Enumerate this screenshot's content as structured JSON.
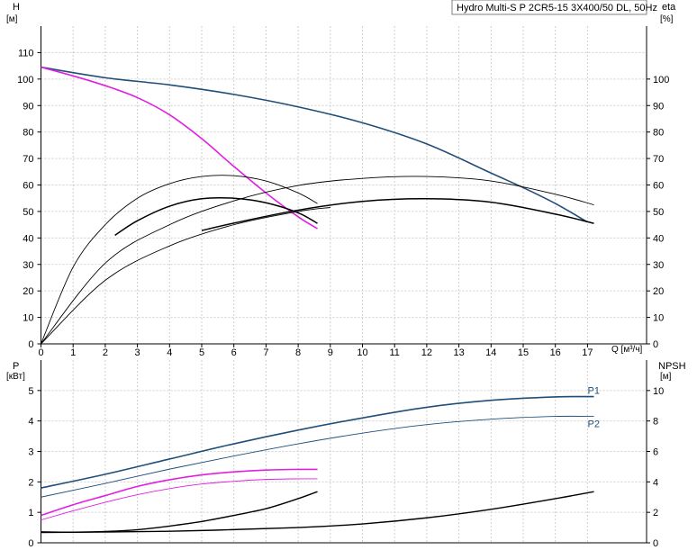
{
  "chart_data": [
    {
      "type": "line",
      "title": "Hydro Multi-S P 2CR5-15 3X400/50 DL, 50Hz",
      "xlabel": "Q [м³/ч]",
      "ylabel_left": "H",
      "ylabel_left_unit": "[м]",
      "ylabel_right": "eta",
      "ylabel_right_unit": "[%]",
      "xlim": [
        0,
        18
      ],
      "ylim": [
        0,
        120
      ],
      "x_ticks": [
        0,
        1,
        2,
        3,
        4,
        5,
        6,
        7,
        8,
        9,
        10,
        11,
        12,
        13,
        14,
        15,
        16,
        17
      ],
      "y_ticks_left": [
        0,
        10,
        20,
        30,
        40,
        50,
        60,
        70,
        80,
        90,
        100,
        110
      ],
      "y_ticks_right": [
        0,
        10,
        20,
        30,
        40,
        50,
        60,
        70,
        80,
        90,
        100
      ],
      "grid": true,
      "series": [
        {
          "color": "#1f4e79",
          "width": 1.6,
          "x": [
            0,
            2,
            4,
            6,
            8,
            10,
            12,
            14,
            15,
            16,
            17
          ],
          "y": [
            104.5,
            100.5,
            97.8,
            94.2,
            89.5,
            83.5,
            75.5,
            64.5,
            59,
            53,
            46
          ]
        },
        {
          "color": "#e020e0",
          "width": 1.6,
          "x": [
            0,
            1,
            2,
            3,
            4,
            5,
            6,
            7,
            8,
            8.6
          ],
          "y": [
            104.5,
            101.2,
            97.5,
            93,
            86.5,
            77.5,
            67,
            57,
            48,
            43.5
          ]
        },
        {
          "color": "#000000",
          "width": 0.9,
          "x": [
            0,
            1,
            2,
            3,
            4,
            5,
            6,
            7,
            8,
            8.6
          ],
          "y": [
            0,
            29,
            45,
            55,
            60.5,
            63.2,
            63.5,
            61.5,
            57,
            53
          ]
        },
        {
          "color": "#000000",
          "width": 1.5,
          "x": [
            2.3,
            3,
            4,
            5,
            6,
            7,
            8,
            8.6
          ],
          "y": [
            41,
            46.5,
            52,
            54.8,
            55,
            53.3,
            49.5,
            45.5
          ]
        },
        {
          "color": "#000000",
          "width": 0.9,
          "x": [
            0,
            2,
            4,
            6,
            8,
            10,
            12,
            14,
            16,
            17.2
          ],
          "y": [
            0,
            30.5,
            45,
            54,
            59.8,
            62.5,
            63.2,
            61.5,
            56.5,
            52.5
          ]
        },
        {
          "color": "#000000",
          "width": 0.9,
          "x": [
            0,
            2,
            4,
            6,
            8,
            9
          ],
          "y": [
            0,
            24,
            37,
            45,
            50,
            51.5
          ]
        },
        {
          "color": "#000000",
          "width": 1.5,
          "x": [
            5,
            6,
            8,
            10,
            12,
            14,
            16,
            17.2
          ],
          "y": [
            42.8,
            45.6,
            50.5,
            53.8,
            54.8,
            53.5,
            49,
            45.5
          ]
        }
      ]
    },
    {
      "type": "line",
      "xlabel": "",
      "ylabel_left": "P",
      "ylabel_left_unit": "[кВт]",
      "ylabel_right": "NPSH",
      "ylabel_right_unit": "[м]",
      "xlim": [
        0,
        18
      ],
      "ylim": [
        0,
        6
      ],
      "y_ticks_left": [
        0,
        1,
        2,
        3,
        4,
        5
      ],
      "y_ticks_right": [
        0,
        2,
        4,
        6,
        8,
        10
      ],
      "grid": true,
      "series": [
        {
          "name": "P1",
          "color": "#1f4e79",
          "width": 1.6,
          "x": [
            0,
            2,
            4,
            6,
            8,
            10,
            12,
            14,
            16,
            17.2
          ],
          "y": [
            1.8,
            2.25,
            2.75,
            3.25,
            3.7,
            4.1,
            4.45,
            4.68,
            4.79,
            4.8
          ]
        },
        {
          "name": "P2",
          "color": "#1f4e79",
          "width": 0.9,
          "x": [
            0,
            2,
            4,
            6,
            8,
            10,
            12,
            14,
            16,
            17.2
          ],
          "y": [
            1.5,
            1.95,
            2.42,
            2.85,
            3.25,
            3.6,
            3.88,
            4.06,
            4.15,
            4.15
          ]
        },
        {
          "color": "#e020e0",
          "width": 1.6,
          "x": [
            0,
            1,
            2,
            3,
            4,
            5,
            6,
            7,
            8,
            8.6
          ],
          "y": [
            0.9,
            1.25,
            1.55,
            1.85,
            2.07,
            2.23,
            2.33,
            2.39,
            2.41,
            2.41
          ]
        },
        {
          "color": "#e020e0",
          "width": 0.9,
          "x": [
            0,
            1,
            2,
            3,
            4,
            5,
            6,
            7,
            8,
            8.6
          ],
          "y": [
            0.75,
            1.05,
            1.33,
            1.58,
            1.78,
            1.93,
            2.02,
            2.08,
            2.1,
            2.1
          ]
        },
        {
          "color": "#000000",
          "width": 1.4,
          "x": [
            0,
            1,
            2,
            3,
            4,
            5,
            6,
            7,
            8,
            8.6
          ],
          "y": [
            0.36,
            0.35,
            0.37,
            0.43,
            0.55,
            0.7,
            0.9,
            1.12,
            1.45,
            1.68
          ]
        },
        {
          "color": "#000000",
          "width": 1.4,
          "x": [
            0,
            4,
            8,
            10,
            12,
            14,
            16,
            17.2
          ],
          "y": [
            0.34,
            0.38,
            0.5,
            0.62,
            0.82,
            1.1,
            1.45,
            1.68
          ]
        }
      ]
    }
  ]
}
